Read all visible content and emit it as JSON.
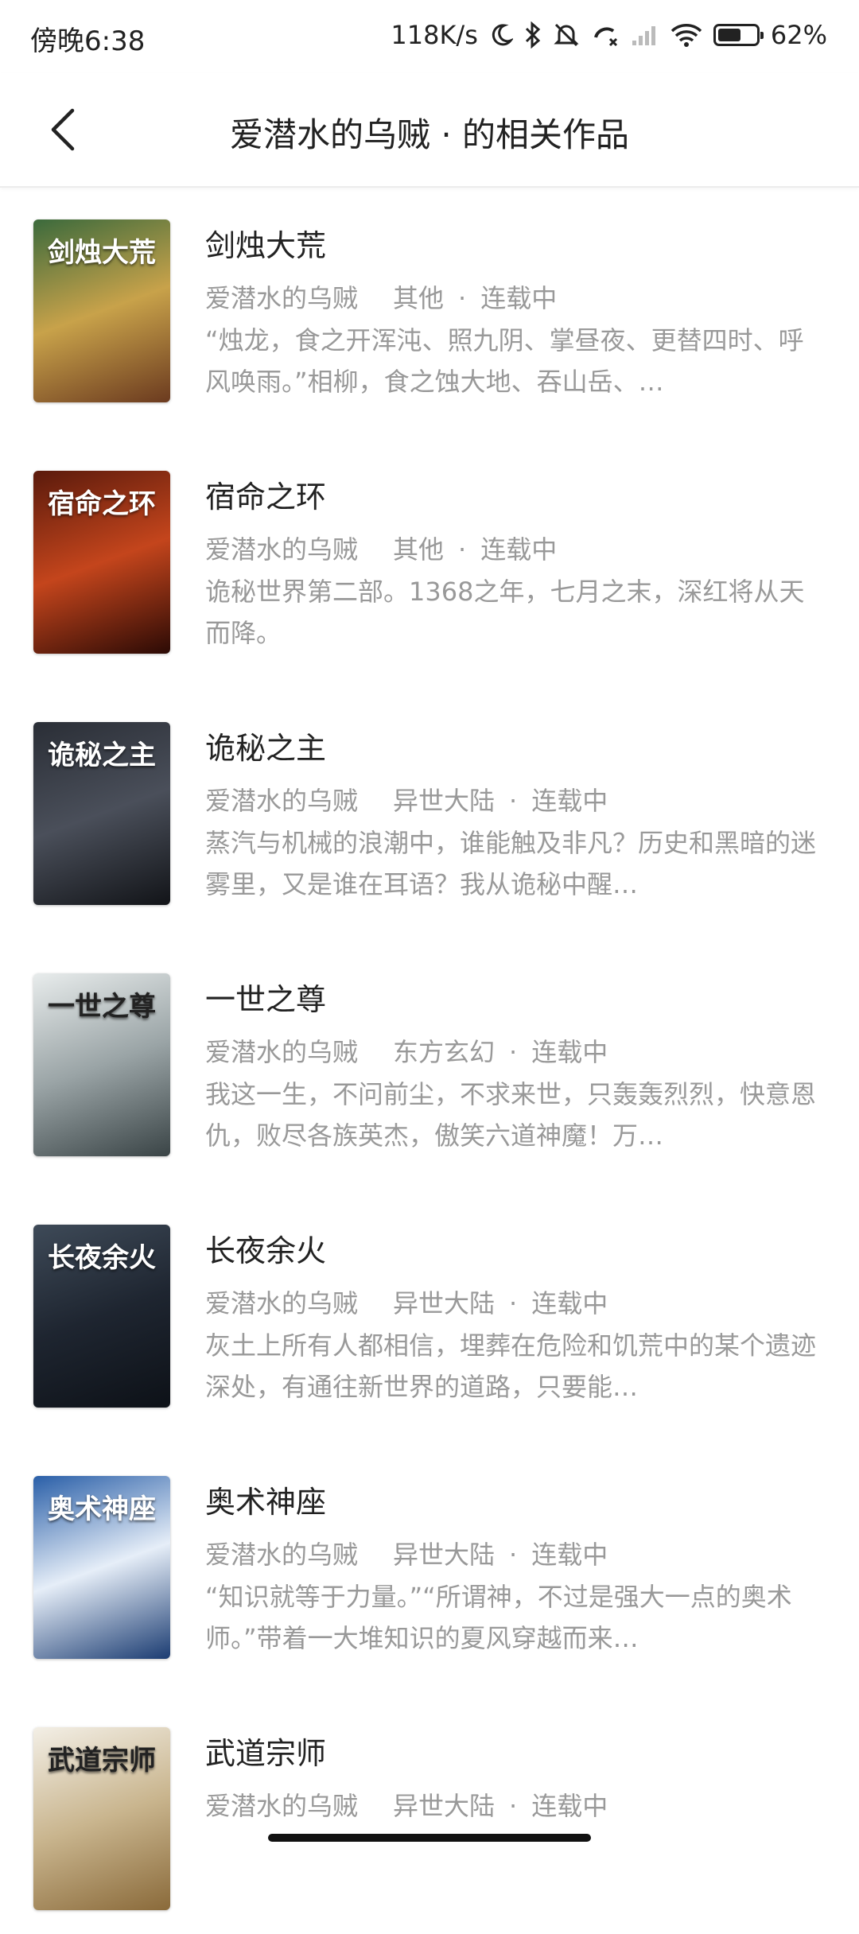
{
  "status": {
    "time": "傍晚6:38",
    "speed": "118K/s",
    "battery": "62%",
    "battery_level": 0.62,
    "icons": [
      "moon-icon",
      "bluetooth-icon",
      "mute-icon",
      "call-icon",
      "signal-icon",
      "wifi-icon",
      "battery-icon"
    ]
  },
  "header": {
    "title": "爱潜水的乌贼 · 的相关作品",
    "back_icon": "chevron-left-icon"
  },
  "books": [
    {
      "title": "剑烛大荒",
      "author": "爱潜水的乌贼",
      "category": "其他",
      "status": "连载中",
      "sep": "·",
      "desc": "“烛龙，食之开浑沌、照九阴、掌昼夜、更替四时、呼风唤雨。”相柳，食之蚀大地、吞山岳、…",
      "cover_text": "剑烛大荒",
      "cover_colors": [
        "#3b6a3c",
        "#c8a24a",
        "#6b3a1f"
      ]
    },
    {
      "title": "宿命之环",
      "author": "爱潜水的乌贼",
      "category": "其他",
      "status": "连载中",
      "sep": "·",
      "desc": "诡秘世界第二部。1368之年，七月之末，深红将从天而降。",
      "cover_text": "宿命之环",
      "cover_colors": [
        "#5a1a0c",
        "#c4451c",
        "#2b0a05"
      ]
    },
    {
      "title": "诡秘之主",
      "author": "爱潜水的乌贼",
      "category": "异世大陆",
      "status": "连载中",
      "sep": "·",
      "desc": "蒸汽与机械的浪潮中，谁能触及非凡？历史和黑暗的迷雾里，又是谁在耳语？我从诡秘中醒…",
      "cover_text": "诡秘之主",
      "cover_colors": [
        "#2a2e36",
        "#4a4f5a",
        "#121418"
      ]
    },
    {
      "title": "一世之尊",
      "author": "爱潜水的乌贼",
      "category": "东方玄幻",
      "status": "连载中",
      "sep": "·",
      "desc": "我这一生，不问前尘，不求来世，只轰轰烈烈，快意恩仇，败尽各族英杰，傲笑六道神魔！万…",
      "cover_text": "一世之尊",
      "cover_colors": [
        "#e8ecec",
        "#9aa4a6",
        "#3a4446"
      ]
    },
    {
      "title": "长夜余火",
      "author": "爱潜水的乌贼",
      "category": "异世大陆",
      "status": "连载中",
      "sep": "·",
      "desc": "灰土上所有人都相信，埋葬在危险和饥荒中的某个遗迹深处，有通往新世界的道路，只要能…",
      "cover_text": "长夜余火",
      "cover_colors": [
        "#3e4a58",
        "#1e2530",
        "#0d1117"
      ]
    },
    {
      "title": "奥术神座",
      "author": "爱潜水的乌贼",
      "category": "异世大陆",
      "status": "连载中",
      "sep": "·",
      "desc": "“知识就等于力量。”“所谓神，不过是强大一点的奥术师。”带着一大堆知识的夏风穿越而来…",
      "cover_text": "奥术神座",
      "cover_colors": [
        "#2a5fa8",
        "#e6eef8",
        "#1b3c72"
      ]
    },
    {
      "title": "武道宗师",
      "author": "爱潜水的乌贼",
      "category": "异世大陆",
      "status": "连载中",
      "sep": "·",
      "desc": "",
      "cover_text": "武道宗师",
      "cover_colors": [
        "#f3efe6",
        "#c9b58e",
        "#8a6a3a"
      ]
    }
  ]
}
